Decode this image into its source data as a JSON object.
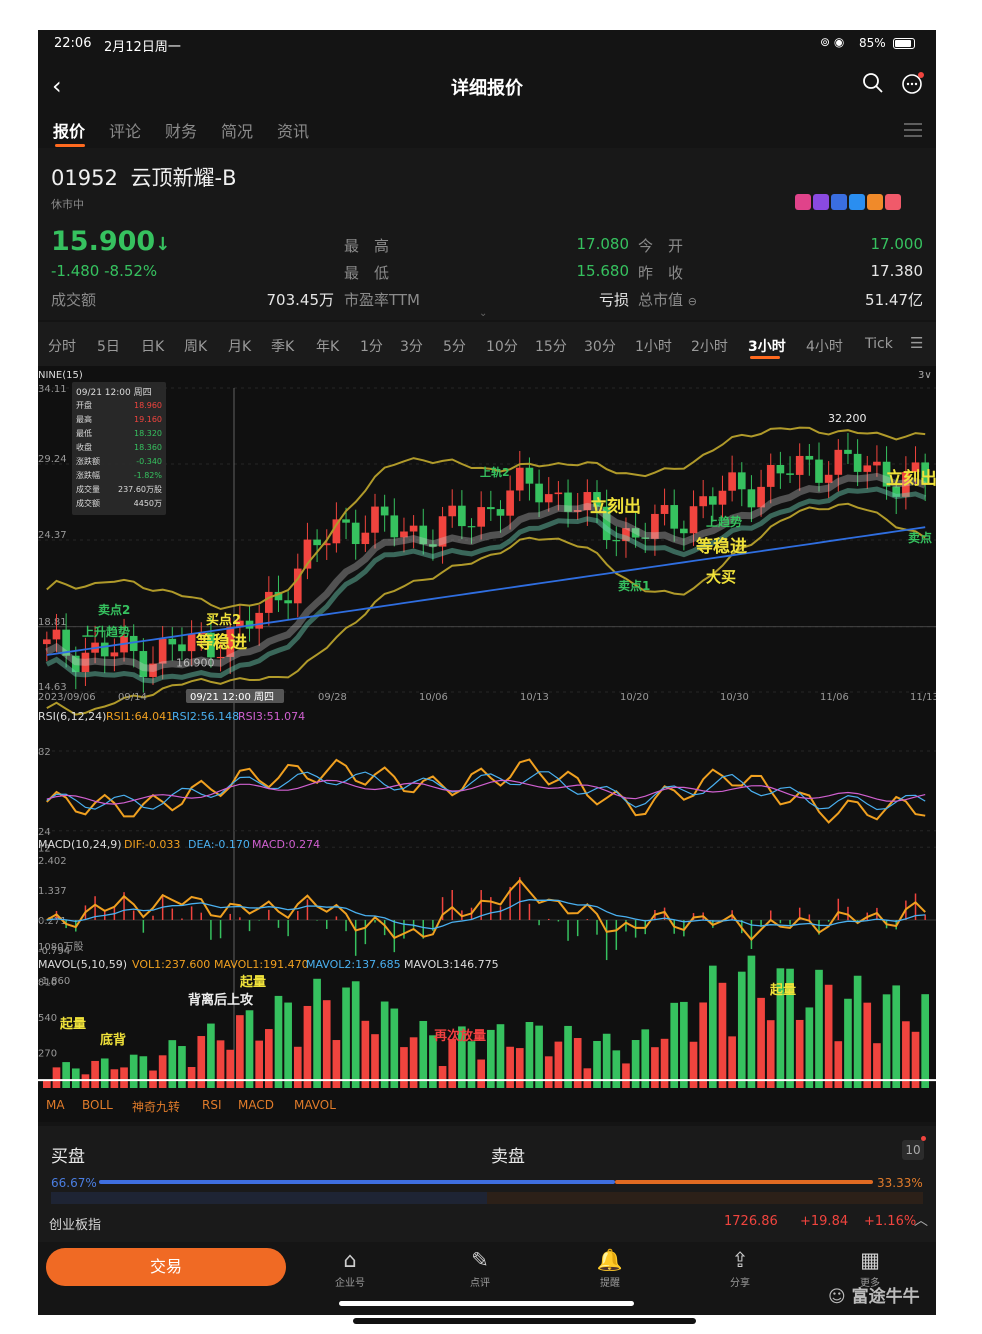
{
  "status": {
    "time": "22:06",
    "date": "2月12日周一",
    "battery": "85%"
  },
  "nav": {
    "title": "详细报价",
    "back_icon": "back-arrow-icon",
    "search_icon": "search-icon",
    "message_icon": "message-icon"
  },
  "tabs": [
    "报价",
    "评论",
    "财务",
    "简况",
    "资讯"
  ],
  "stock": {
    "code": "01952",
    "name": "云顶新耀-B",
    "status": "休市中",
    "price": "15.900",
    "price_arrow": "↓",
    "change": "-1.480 -8.52%",
    "high_label": "最　高",
    "high": "17.080",
    "open_label": "今　开",
    "open": "17.000",
    "low_label": "最　低",
    "low": "15.680",
    "prev_label": "昨　收",
    "prev": "17.380",
    "turnover_label": "成交额",
    "turnover": "703.45万",
    "pe_label": "市盈率TTM",
    "pe_value": "亏损",
    "mcap_label": "总市值",
    "mcap": "51.47亿"
  },
  "periods": [
    "分时",
    "5日",
    "日K",
    "周K",
    "月K",
    "季K",
    "年K",
    "1分",
    "3分",
    "5分",
    "10分",
    "15分",
    "30分",
    "1小时",
    "2小时",
    "3小时",
    "4小时",
    "Tick"
  ],
  "active_period": "3小时",
  "main_chart": {
    "indicator": "NINE(15)",
    "scale_btn": "3∨",
    "y_ticks": [
      "34.11",
      "29.24",
      "24.37",
      "18.81",
      "14.63"
    ],
    "x_ticks": [
      "2023/09/06",
      "09/14",
      "09/28",
      "10/06",
      "10/13",
      "10/20",
      "10/30",
      "11/06",
      "11/13"
    ],
    "crosshair_date": "09/21 12:00 周四",
    "high_mark": "32.200",
    "low_mark": "16.900",
    "signals": [
      "上轨2",
      "立刻出",
      "上趋势",
      "等稳进",
      "大买",
      "卖点1",
      "立刻出",
      "卖点",
      "等稳进",
      "买点2",
      "卖点2",
      "上升趋势"
    ],
    "tooltip": {
      "date": "09/21 12:00 周四",
      "rows": [
        {
          "k": "开盘",
          "v": "18.960"
        },
        {
          "k": "最高",
          "v": "19.160"
        },
        {
          "k": "最低",
          "v": "18.320"
        },
        {
          "k": "收盘",
          "v": "18.360"
        },
        {
          "k": "涨跌额",
          "v": "-0.340"
        },
        {
          "k": "涨跌幅",
          "v": "-1.82%"
        },
        {
          "k": "成交量",
          "v": "237.60万股"
        },
        {
          "k": "成交额",
          "v": "4450万"
        }
      ]
    }
  },
  "rsi": {
    "title": "RSI(6,12,24)",
    "rsi1": "RSI1:64.041",
    "rsi2": "RSI2:56.148",
    "rsi3": "RSI3:51.074",
    "y_ticks": [
      "82",
      "24",
      "12"
    ]
  },
  "macd": {
    "title": "MACD(10,24,9)",
    "dif": "DIF:-0.033",
    "dea": "DEA:-0.170",
    "macd": "MACD:0.274",
    "y_ticks": [
      "2.402",
      "1.337",
      "0.271",
      "-0.794",
      "-1.860"
    ]
  },
  "mavol": {
    "title": "MAVOL(5,10,59)",
    "vol": "VOL1:237.600",
    "m1": "MAVOL1:191.470",
    "m2": "MAVOL2:137.685",
    "m3": "MAVOL3:146.775",
    "y_ticks": [
      "1080万股",
      "810",
      "540",
      "270"
    ],
    "labels": [
      "起量",
      "底背",
      "背离后上攻",
      "起量",
      "起量",
      "再次放量"
    ]
  },
  "indicator_tabs": [
    "MA",
    "BOLL",
    "神奇九转",
    "RSI",
    "MACD",
    "MAVOL"
  ],
  "order_book": {
    "buy": "买盘",
    "sell": "卖盘",
    "depth": "10",
    "buy_pct": "66.67%",
    "sell_pct": "33.33%"
  },
  "index": {
    "name": "创业板指",
    "value": "1726.86",
    "change": "+19.84",
    "pct": "+1.16%"
  },
  "bottom": {
    "trade": "交易",
    "items": [
      {
        "label": "企业号",
        "icon": "building-icon"
      },
      {
        "label": "点评",
        "icon": "pen-icon"
      },
      {
        "label": "提醒",
        "icon": "bell-icon"
      },
      {
        "label": "分享",
        "icon": "share-icon"
      },
      {
        "label": "更多",
        "icon": "grid-icon"
      }
    ],
    "watermark": "富途牛牛"
  },
  "colors": {
    "accent": "#ff6a1f",
    "up": "#f0443e",
    "down": "#36c15f"
  },
  "chart_data": [
    {
      "type": "candlestick",
      "title": "NINE(15)",
      "x": [
        "2023/09/06",
        "09/14",
        "09/21",
        "09/28",
        "10/06",
        "10/13",
        "10/20",
        "10/30",
        "11/06",
        "11/13"
      ],
      "close": [
        17.4,
        17.0,
        18.36,
        25.5,
        24.8,
        28.0,
        24.5,
        27.5,
        29.5,
        28.0
      ],
      "ylim": [
        14.63,
        34.11
      ]
    },
    {
      "type": "line",
      "title": "RSI(6,12,24)",
      "series": [
        {
          "name": "RSI1",
          "values": [
            45,
            40,
            62,
            68,
            55,
            70,
            40,
            65,
            38,
            42
          ]
        },
        {
          "name": "RSI2",
          "values": [
            46,
            44,
            58,
            63,
            56,
            64,
            46,
            60,
            44,
            45
          ]
        },
        {
          "name": "RSI3",
          "values": [
            47,
            46,
            55,
            58,
            55,
            59,
            50,
            56,
            49,
            48
          ]
        }
      ]
    },
    {
      "type": "bar",
      "title": "MAVOL(5,10,59)",
      "values": [
        120,
        180,
        400,
        600,
        300,
        350,
        250,
        700,
        600,
        500
      ]
    }
  ]
}
